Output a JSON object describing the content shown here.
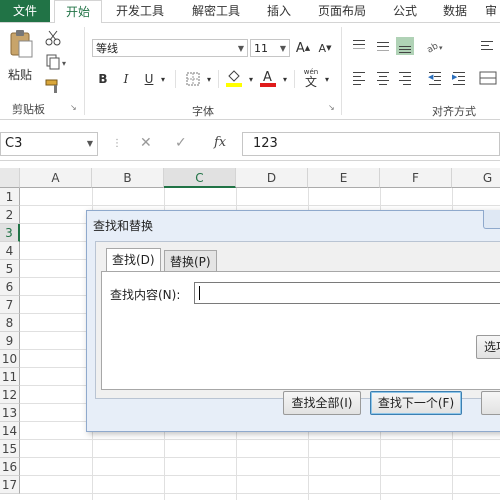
{
  "ribbon_tabs": [
    "文件",
    "开始",
    "开发工具",
    "解密工具",
    "插入",
    "页面布局",
    "公式",
    "数据",
    "审"
  ],
  "clipboard": {
    "paste_label": "粘贴",
    "group_label": "剪贴板"
  },
  "font": {
    "name": "等线",
    "size": "11",
    "group_label": "字体",
    "bold": "B",
    "italic": "I",
    "underline": "U",
    "grow": "A",
    "shrink": "A",
    "wen": "wén",
    "wen_char": "文"
  },
  "alignment": {
    "group_label": "对齐方式"
  },
  "formula_bar": {
    "name_box": "C3",
    "cancel": "✕",
    "enter": "✓",
    "fx": "fx",
    "value": "123"
  },
  "sheet": {
    "columns": [
      "A",
      "B",
      "C",
      "D",
      "E",
      "F",
      "G"
    ],
    "rows": [
      "1",
      "2",
      "3",
      "4",
      "5",
      "6",
      "7",
      "8",
      "9",
      "10",
      "11",
      "12",
      "13",
      "14",
      "15",
      "16",
      "17"
    ],
    "selected_column": "C",
    "selected_row": "3"
  },
  "dialog": {
    "title": "查找和替换",
    "tab_find": "查找(D)",
    "tab_replace": "替换(P)",
    "find_label": "查找内容(N):",
    "find_value": "",
    "options_button": "选项",
    "find_all_button": "查找全部(I)",
    "find_next_button": "查找下一个(F)"
  },
  "colors": {
    "excel_green": "#217346",
    "dialog_bg": "#e7eef8"
  }
}
